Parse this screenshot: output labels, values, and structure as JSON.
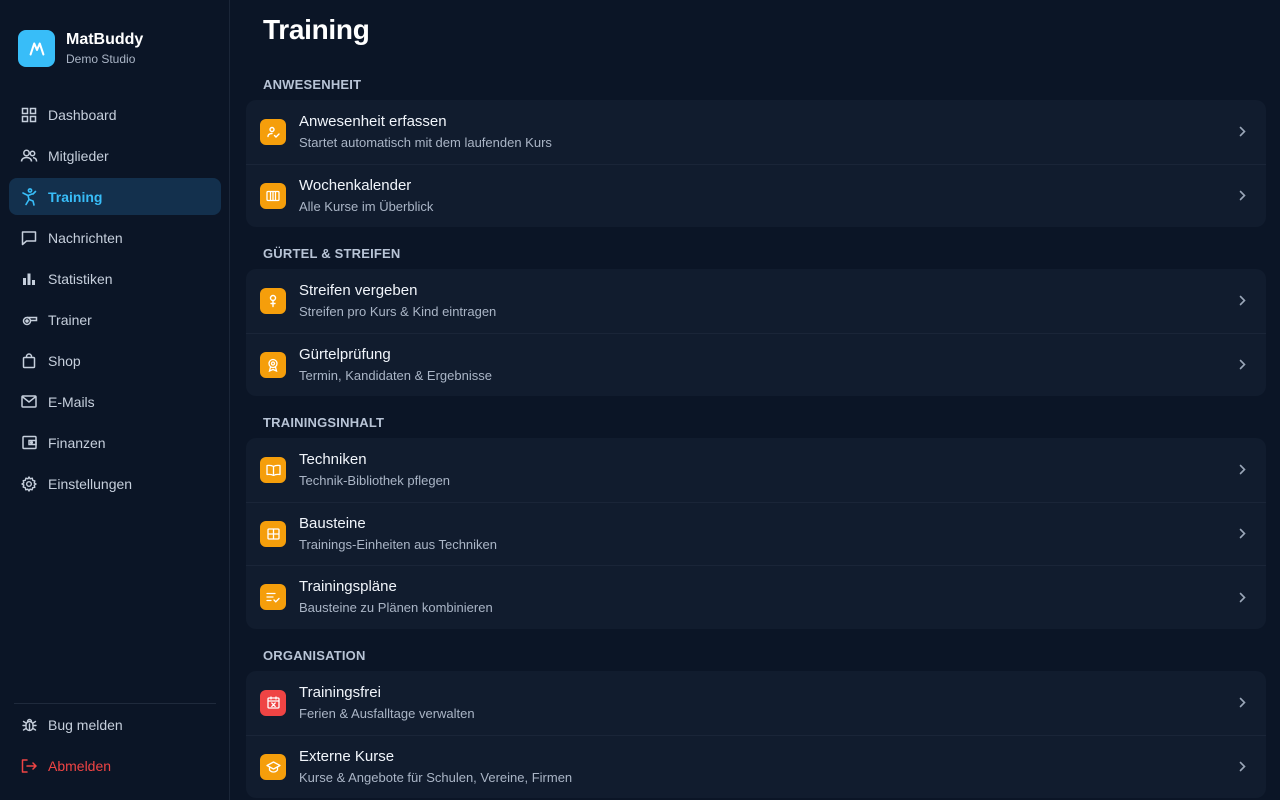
{
  "brand": {
    "name": "MatBuddy",
    "subtitle": "Demo Studio",
    "accent": "#38bdf8"
  },
  "sidebar": {
    "items": [
      {
        "label": "Dashboard",
        "icon": "grid-icon"
      },
      {
        "label": "Mitglieder",
        "icon": "users-icon"
      },
      {
        "label": "Training",
        "icon": "martial-arts-icon",
        "active": true
      },
      {
        "label": "Nachrichten",
        "icon": "message-icon"
      },
      {
        "label": "Statistiken",
        "icon": "bar-chart-icon"
      },
      {
        "label": "Trainer",
        "icon": "whistle-icon"
      },
      {
        "label": "Shop",
        "icon": "shopping-bag-icon"
      },
      {
        "label": "E-Mails",
        "icon": "mail-icon"
      },
      {
        "label": "Finanzen",
        "icon": "wallet-icon"
      },
      {
        "label": "Einstellungen",
        "icon": "gear-icon"
      }
    ],
    "bottom": [
      {
        "label": "Bug melden",
        "icon": "bug-icon"
      },
      {
        "label": "Abmelden",
        "icon": "logout-icon",
        "color": "#ef4444"
      }
    ]
  },
  "page": {
    "title": "Training"
  },
  "sections": [
    {
      "title": "ANWESENHEIT",
      "rows": [
        {
          "title": "Anwesenheit erfassen",
          "subtitle": "Startet automatisch mit dem laufenden Kurs",
          "icon": "check-person-icon",
          "color": "#f59e0b"
        },
        {
          "title": "Wochenkalender",
          "subtitle": "Alle Kurse im Überblick",
          "icon": "calendar-week-icon",
          "color": "#f59e0b"
        }
      ]
    },
    {
      "title": "GÜRTEL & STREIFEN",
      "rows": [
        {
          "title": "Streifen vergeben",
          "subtitle": "Streifen pro Kurs & Kind eintragen",
          "icon": "stripe-icon",
          "color": "#f59e0b"
        },
        {
          "title": "Gürtelprüfung",
          "subtitle": "Termin, Kandidaten & Ergebnisse",
          "icon": "award-icon",
          "color": "#f59e0b"
        }
      ]
    },
    {
      "title": "TRAININGSINHALT",
      "rows": [
        {
          "title": "Techniken",
          "subtitle": "Technik-Bibliothek pflegen",
          "icon": "book-icon",
          "color": "#f59e0b"
        },
        {
          "title": "Bausteine",
          "subtitle": "Trainings-Einheiten aus Techniken",
          "icon": "blocks-icon",
          "color": "#f59e0b"
        },
        {
          "title": "Trainingspläne",
          "subtitle": "Bausteine zu Plänen kombinieren",
          "icon": "list-check-icon",
          "color": "#f59e0b"
        }
      ]
    },
    {
      "title": "ORGANISATION",
      "rows": [
        {
          "title": "Trainingsfrei",
          "subtitle": "Ferien & Ausfalltage verwalten",
          "icon": "calendar-x-icon",
          "color": "#ef4444"
        },
        {
          "title": "Externe Kurse",
          "subtitle": "Kurse & Angebote für Schulen, Vereine, Firmen",
          "icon": "graduation-cap-icon",
          "color": "#f59e0b"
        }
      ]
    }
  ]
}
